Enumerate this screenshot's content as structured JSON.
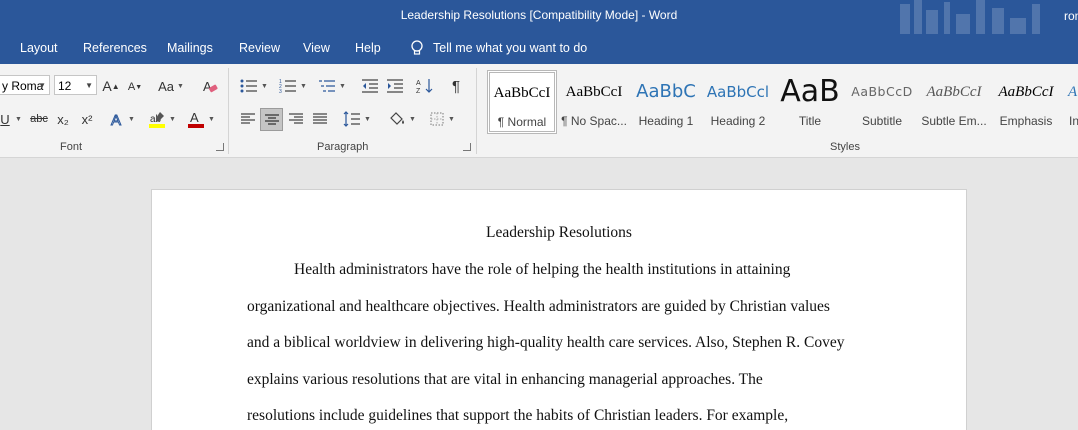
{
  "titlebar": {
    "title": "Leadership Resolutions [Compatibility Mode]  -  Word",
    "user": "ron"
  },
  "menu": {
    "tabs": [
      "Layout",
      "References",
      "Mailings",
      "Review",
      "View",
      "Help"
    ],
    "tell_me": "Tell me what you want to do"
  },
  "ribbon": {
    "font": {
      "name": "y Roma",
      "size": "12",
      "group_label": "Font",
      "case_label": "Aa",
      "grow": "A",
      "shrink": "A",
      "strike": "abc",
      "subscript": "x₂",
      "superscript": "x²",
      "font_color_letter": "A"
    },
    "paragraph": {
      "group_label": "Paragraph"
    },
    "styles": {
      "group_label": "Styles",
      "items": [
        {
          "preview": "AaBbCcI",
          "label": "¶ Normal"
        },
        {
          "preview": "AaBbCcI",
          "label": "¶ No Spac..."
        },
        {
          "preview": "AaBbC",
          "label": "Heading 1"
        },
        {
          "preview": "AaBbCcl",
          "label": "Heading 2"
        },
        {
          "preview": "AaB",
          "label": "Title"
        },
        {
          "preview": "AaBbCcD",
          "label": "Subtitle"
        },
        {
          "preview": "AaBbCcI",
          "label": "Subtle Em..."
        },
        {
          "preview": "AaBbCcI",
          "label": "Emphasis"
        },
        {
          "preview": "A",
          "label": "In"
        }
      ]
    }
  },
  "document": {
    "title": "Leadership Resolutions",
    "lines": [
      "Health administrators have the role of helping the health institutions in attaining",
      "organizational and healthcare objectives. Health administrators are guided by Christian values",
      "and a biblical worldview in delivering high-quality health care services. Also, Stephen R. Covey",
      "explains various resolutions that are vital in enhancing managerial approaches. The",
      "resolutions include guidelines that support the habits of Christian leaders. For example,"
    ]
  },
  "colors": {
    "ribbon_blue": "#2b579a",
    "font_color_bar": "#c00000",
    "highlight": "#ffff00"
  }
}
